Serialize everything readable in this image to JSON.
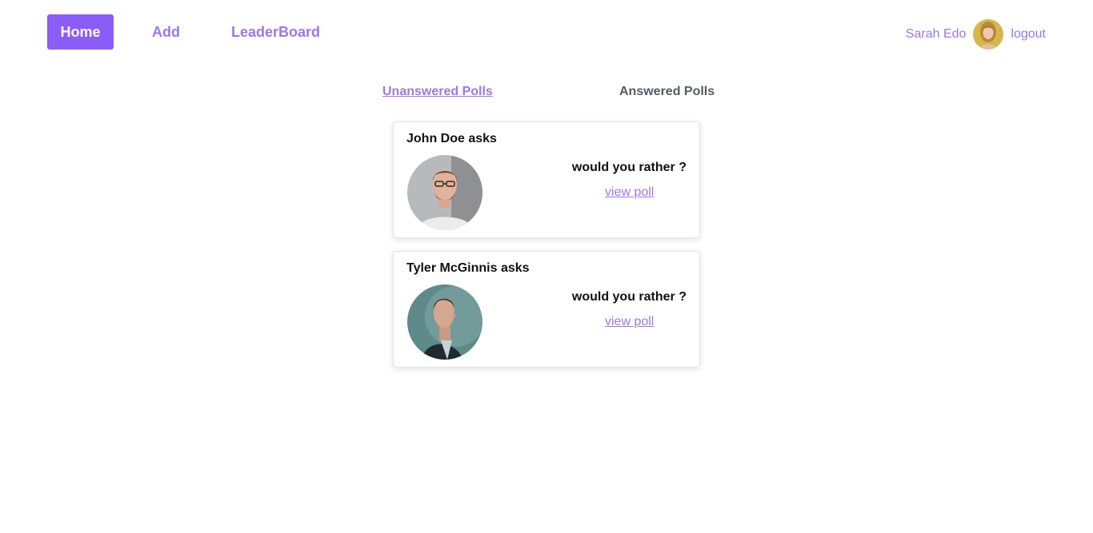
{
  "nav": {
    "home_label": "Home",
    "add_label": "Add",
    "leaderboard_label": "LeaderBoard"
  },
  "user": {
    "name": "Sarah Edo",
    "logout_label": "logout"
  },
  "tabs": {
    "unanswered_label": "Unanswered Polls",
    "answered_label": "Answered Polls"
  },
  "polls": [
    {
      "asker": "John Doe asks",
      "question": "would you rather ?",
      "link_label": "view poll"
    },
    {
      "asker": "Tyler McGinnis asks",
      "question": "would you rather ?",
      "link_label": "view poll"
    }
  ],
  "colors": {
    "accent": "#8b5cf6",
    "link": "#9a78ea",
    "muted_tab": "#555a66"
  }
}
